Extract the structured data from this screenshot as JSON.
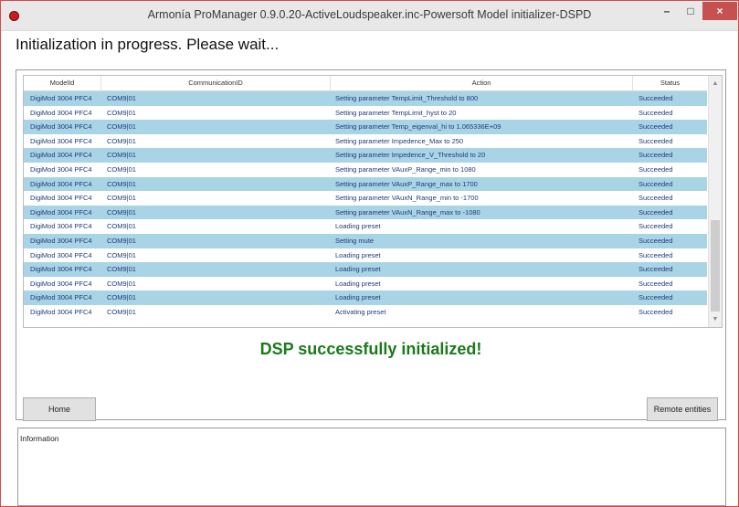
{
  "window": {
    "title": "Armonía ProManager 0.9.0.20-ActiveLoudspeaker.inc-Powersoft Model initializer-DSPD",
    "minimize_glyph": "–",
    "maximize_glyph": "□",
    "close_glyph": "×"
  },
  "heading": "Initialization in progress. Please wait...",
  "grid": {
    "columns": {
      "model": "ModelId",
      "comm": "CommunicationID",
      "action": "Action",
      "status": "Status"
    },
    "rows": [
      {
        "model": "DigiMod 3004 PFC4",
        "comm": "COM9|01",
        "action": "Setting parameter TempLimit_Threshold to 800",
        "status": "Succeeded"
      },
      {
        "model": "DigiMod 3004 PFC4",
        "comm": "COM9|01",
        "action": "Setting parameter TempLimit_hyst to 20",
        "status": "Succeeded"
      },
      {
        "model": "DigiMod 3004 PFC4",
        "comm": "COM9|01",
        "action": "Setting parameter Temp_eigenval_hi to 1.065336E+09",
        "status": "Succeeded"
      },
      {
        "model": "DigiMod 3004 PFC4",
        "comm": "COM9|01",
        "action": "Setting parameter Impedence_Max to 250",
        "status": "Succeeded"
      },
      {
        "model": "DigiMod 3004 PFC4",
        "comm": "COM9|01",
        "action": "Setting parameter Impedence_V_Threshold to 20",
        "status": "Succeeded"
      },
      {
        "model": "DigiMod 3004 PFC4",
        "comm": "COM9|01",
        "action": "Setting parameter VAuxP_Range_min to 1080",
        "status": "Succeeded"
      },
      {
        "model": "DigiMod 3004 PFC4",
        "comm": "COM9|01",
        "action": "Setting parameter VAuxP_Range_max to 1700",
        "status": "Succeeded"
      },
      {
        "model": "DigiMod 3004 PFC4",
        "comm": "COM9|01",
        "action": "Setting parameter VAuxN_Range_min to -1700",
        "status": "Succeeded"
      },
      {
        "model": "DigiMod 3004 PFC4",
        "comm": "COM9|01",
        "action": "Setting parameter VAuxN_Range_max to -1080",
        "status": "Succeeded"
      },
      {
        "model": "DigiMod 3004 PFC4",
        "comm": "COM9|01",
        "action": "Loading preset",
        "status": "Succeeded"
      },
      {
        "model": "DigiMod 3004 PFC4",
        "comm": "COM9|01",
        "action": "Setting mute",
        "status": "Succeeded"
      },
      {
        "model": "DigiMod 3004 PFC4",
        "comm": "COM9|01",
        "action": "Loading preset",
        "status": "Succeeded"
      },
      {
        "model": "DigiMod 3004 PFC4",
        "comm": "COM9|01",
        "action": "Loading preset",
        "status": "Succeeded"
      },
      {
        "model": "DigiMod 3004 PFC4",
        "comm": "COM9|01",
        "action": "Loading preset",
        "status": "Succeeded"
      },
      {
        "model": "DigiMod 3004 PFC4",
        "comm": "COM9|01",
        "action": "Loading preset",
        "status": "Succeeded"
      },
      {
        "model": "DigiMod 3004 PFC4",
        "comm": "COM9|01",
        "action": "Activating preset",
        "status": "Succeeded"
      }
    ]
  },
  "success_message": "DSP successfully initialized!",
  "buttons": {
    "home": "Home",
    "remote": "Remote entities"
  },
  "info_label": "Information",
  "colors": {
    "row_highlight": "#a9d4e6",
    "row_text": "#1f3a7a",
    "success_text": "#1a7a1a",
    "close_button": "#c75050"
  }
}
